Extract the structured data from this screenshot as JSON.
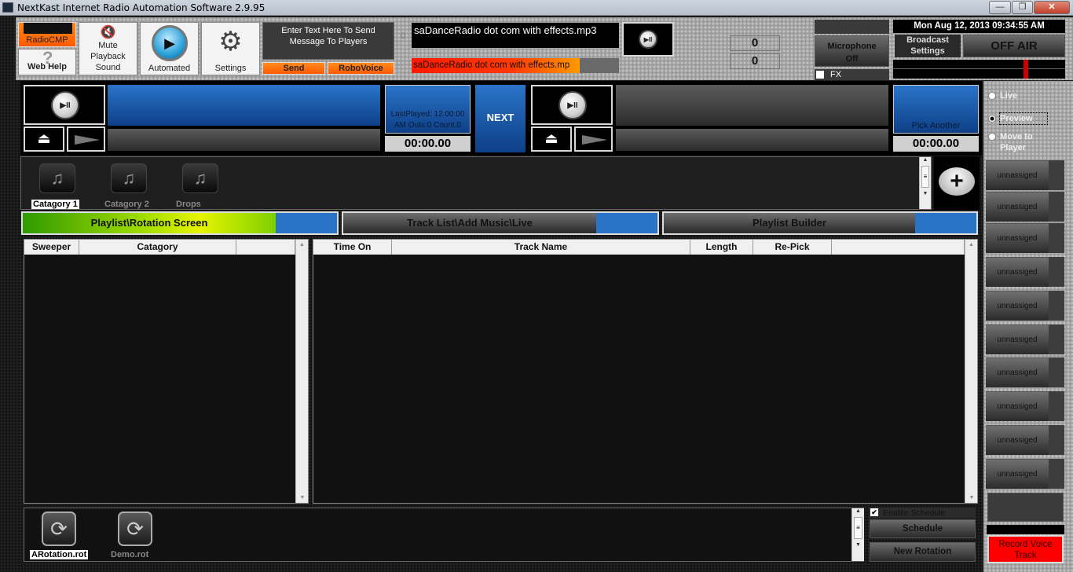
{
  "window": {
    "title": "NextKast Internet Radio Automation Software 2.9.95",
    "minimize": "—",
    "restore": "❐",
    "close": "✕"
  },
  "toolbar": {
    "radiocmp": "RadioCMP",
    "web_help": "Web Help",
    "help_icon": "?",
    "mute": "Mute Playback Sound",
    "mute_icon": "🔇",
    "automated": "Automated",
    "settings": "Settings",
    "gear_icon": "⚙",
    "message_placeholder": "Enter Text Here To Send Message To Players",
    "send": "Send",
    "robovoice": "RoboVoice",
    "zero_small": "0"
  },
  "now_playing": {
    "title": "saDanceRadio dot com with effects.mp3",
    "ticker": "saDanceRadio dot com with effects.mp",
    "ticker_progress": 0.81,
    "play_pause": "▶II"
  },
  "counters": {
    "top": "0",
    "bottom": "0"
  },
  "mic": {
    "label": "Microphone Off",
    "fx": "FX",
    "fx_checked": false
  },
  "clock": "Mon Aug 12, 2013  09:34:55 AM",
  "broadcast": {
    "settings": "Broadcast Settings",
    "status": "OFF AIR",
    "meter_level": 0.76
  },
  "player1": {
    "play_pause": "▶II",
    "eject": "⏏",
    "time": "00:00.00",
    "info": "LastPlayed: 12:00:00 AM Outs:0 Count:0"
  },
  "next": "NEXT",
  "player2": {
    "play_pause": "▶II",
    "eject": "⏏",
    "time": "00:00.00",
    "pick": "Pick Another"
  },
  "mode": {
    "options": [
      "Live",
      "Preview",
      "Move to Player"
    ],
    "selected": "Preview"
  },
  "categories": [
    {
      "label": "Catagory 1",
      "selected": true
    },
    {
      "label": "Catagory 2",
      "selected": false
    },
    {
      "label": "Drops",
      "selected": false
    }
  ],
  "add_icon": "+",
  "tabs": [
    {
      "label": "Playlist\\Rotation Screen",
      "active": true
    },
    {
      "label": "Track List\\Add Music\\Live",
      "active": false
    },
    {
      "label": "Playlist Builder",
      "active": false
    }
  ],
  "left_table": {
    "columns": [
      "Sweeper",
      "Catagory",
      ""
    ],
    "rows": []
  },
  "right_table": {
    "columns": [
      "Time On",
      "Track Name",
      "Length",
      "Re-Pick",
      ""
    ],
    "rows": []
  },
  "slots": [
    "unnassiged",
    "unnassiged",
    "unnassiged",
    "unnassiged",
    "unnassiged",
    "unnassiged",
    "unnassiged",
    "unnassiged",
    "unnassiged",
    "unnassiged"
  ],
  "rotations": [
    {
      "label": "ARotation.rot",
      "selected": true
    },
    {
      "label": "Demo.rot",
      "selected": false
    }
  ],
  "schedule": {
    "enable_label": "Enable Schedule",
    "enabled": true,
    "schedule_btn": "Schedule",
    "new_rotation": "New Rotation"
  },
  "record": "Record Voice Track"
}
